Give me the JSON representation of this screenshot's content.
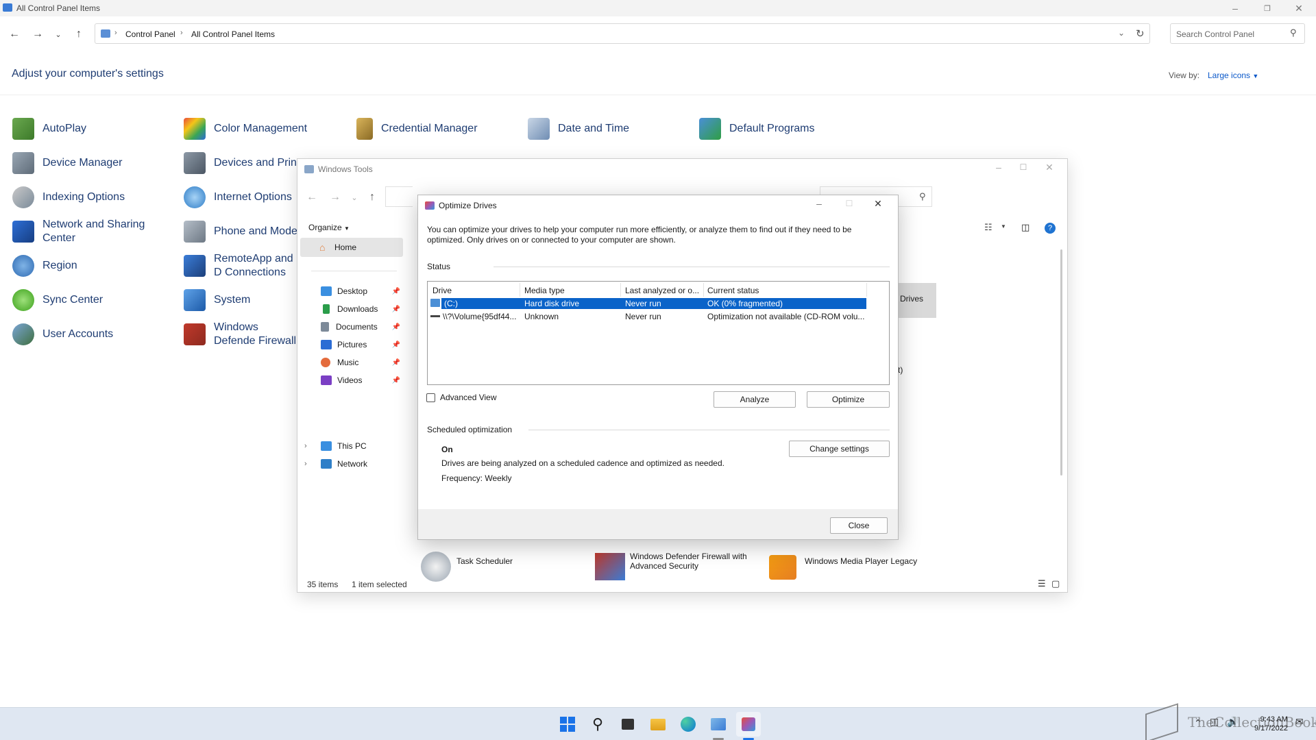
{
  "control_panel": {
    "window_title": "All Control Panel Items",
    "breadcrumb": [
      "Control Panel",
      "All Control Panel Items"
    ],
    "search_placeholder": "Search Control Panel",
    "header": "Adjust your computer's settings",
    "view_by_label": "View by:",
    "view_by_value": "Large icons",
    "items_col1": [
      "AutoPlay",
      "Device Manager",
      "Indexing Options",
      "Network and Sharing Center",
      "Region",
      "Sync Center",
      "User Accounts"
    ],
    "items_col2": [
      "Color Management",
      "Devices and Printers",
      "Internet Options",
      "Phone and Modem",
      "RemoteApp and Desktop Connections",
      "System",
      "Windows Defender Firewall"
    ],
    "items_row1_more": [
      "Credential Manager",
      "Date and Time",
      "Default Programs"
    ],
    "visible_col2": [
      "Color Management",
      "Devices and Print",
      "Internet Options",
      "Phone and Moder",
      "RemoteApp and D Connections",
      "System",
      "Windows Defende Firewall"
    ]
  },
  "windows_tools": {
    "window_title": "Windows Tools",
    "organize_label": "Organize",
    "nav_home": "Home",
    "quick_access": [
      "Desktop",
      "Downloads",
      "Documents",
      "Pictures",
      "Music",
      "Videos"
    ],
    "tree": [
      "This PC",
      "Network"
    ],
    "status_items": "35 items",
    "status_selected": "1 item selected",
    "selected_item_label": "Drives",
    "partial_text": "t)",
    "bottom_items": [
      "Task Scheduler",
      "Windows Defender Firewall with Advanced Security",
      "Windows Media Player Legacy"
    ]
  },
  "optimize_drives": {
    "title": "Optimize Drives",
    "description": "You can optimize your drives to help your computer run more efficiently, or analyze them to find out if they need to be optimized. Only drives on or connected to your computer are shown.",
    "status_label": "Status",
    "columns": [
      "Drive",
      "Media type",
      "Last analyzed or o...",
      "Current status"
    ],
    "rows": [
      {
        "drive": "(C:)",
        "media": "Hard disk drive",
        "last": "Never run",
        "status": "OK (0% fragmented)"
      },
      {
        "drive": "\\\\?\\Volume{95df44...",
        "media": "Unknown",
        "last": "Never run",
        "status": "Optimization not available (CD-ROM volu..."
      }
    ],
    "advanced_view": "Advanced View",
    "analyze_button": "Analyze",
    "optimize_button": "Optimize",
    "scheduled_label": "Scheduled optimization",
    "schedule_state": "On",
    "schedule_desc": "Drives are being analyzed on a scheduled cadence and optimized as needed.",
    "frequency": "Frequency: Weekly",
    "change_settings_button": "Change settings",
    "close_button": "Close"
  },
  "taskbar": {
    "time": "9:43 AM",
    "date": "9/17/2022",
    "watermark": "TheCollectionBook"
  },
  "colors": {
    "accent": "#0a63c9",
    "link": "#1e3c72",
    "taskbar": "#dfe7f2"
  }
}
